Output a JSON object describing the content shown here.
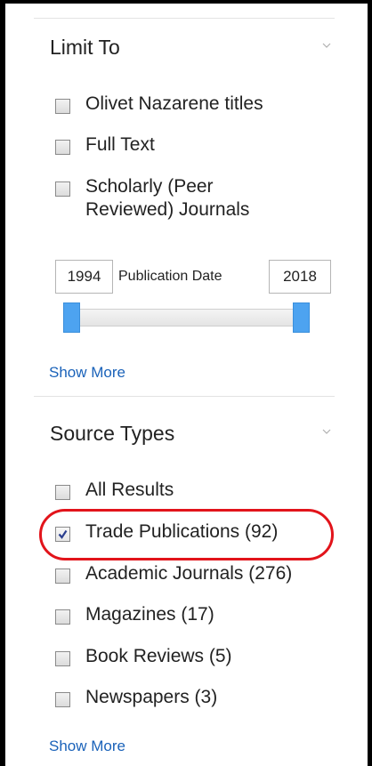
{
  "limit_to": {
    "title": "Limit To",
    "options": [
      {
        "label": "Olivet Nazarene titles",
        "checked": false
      },
      {
        "label": "Full Text",
        "checked": false
      },
      {
        "label": "Scholarly (Peer Reviewed) Journals",
        "line1": "Scholarly (Peer",
        "line2": "Reviewed) Journals",
        "checked": false
      }
    ],
    "publication_date": {
      "label": "Publication Date",
      "from": "1994",
      "to": "2018"
    },
    "show_more": "Show More"
  },
  "source_types": {
    "title": "Source Types",
    "options": [
      {
        "label": "All Results",
        "checked": false
      },
      {
        "label": "Trade Publications (92)",
        "checked": true,
        "highlighted": true
      },
      {
        "label": "Academic Journals (276)",
        "checked": false
      },
      {
        "label": "Magazines (17)",
        "checked": false
      },
      {
        "label": "Book Reviews (5)",
        "checked": false
      },
      {
        "label": "Newspapers (3)",
        "checked": false
      }
    ],
    "show_more": "Show More"
  },
  "colors": {
    "link": "#1a62b9",
    "slider_handle": "#4da3f0",
    "highlight_circle": "#e2141b"
  },
  "icons": {
    "collapse": "chevron-down-icon",
    "check": "checkmark-icon"
  }
}
